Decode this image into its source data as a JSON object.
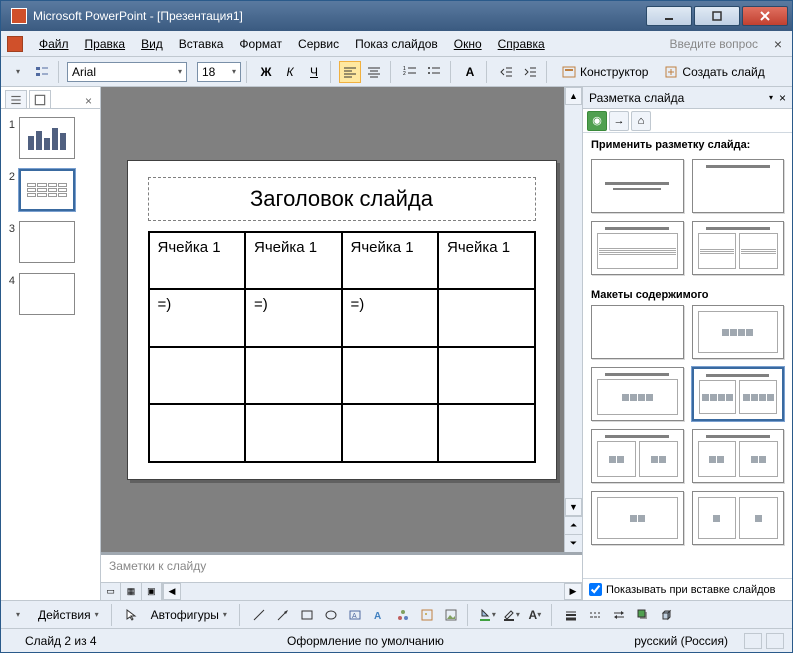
{
  "window": {
    "title": "Microsoft PowerPoint - [Презентация1]"
  },
  "menubar": {
    "items": [
      "Файл",
      "Правка",
      "Вид",
      "Вставка",
      "Формат",
      "Сервис",
      "Показ слайдов",
      "Окно",
      "Справка"
    ],
    "prompt": "Введите вопрос"
  },
  "toolbar": {
    "font_name": "Arial",
    "font_size": "18",
    "constructor_label": "Конструктор",
    "new_slide_label": "Создать слайд"
  },
  "thumbs": {
    "items": [
      {
        "num": "1"
      },
      {
        "num": "2"
      },
      {
        "num": "3"
      },
      {
        "num": "4"
      }
    ]
  },
  "slide": {
    "title": "Заголовок слайда",
    "table": [
      [
        "Ячейка 1",
        "Ячейка 1",
        "Ячейка 1",
        "Ячейка 1"
      ],
      [
        "=)",
        "=)",
        "=)",
        ""
      ],
      [
        "",
        "",
        "",
        ""
      ],
      [
        "",
        "",
        "",
        ""
      ]
    ]
  },
  "notes": {
    "placeholder": "Заметки к слайду"
  },
  "taskpane": {
    "title": "Разметка слайда",
    "apply_label": "Применить разметку слайда:",
    "section2_label": "Макеты содержимого",
    "footer_checkbox": "Показывать при вставке слайдов"
  },
  "drawbar": {
    "actions_label": "Действия",
    "autoshapes_label": "Автофигуры"
  },
  "statusbar": {
    "slide_pos": "Слайд 2 из 4",
    "design": "Оформление по умолчанию",
    "lang": "русский (Россия)"
  }
}
